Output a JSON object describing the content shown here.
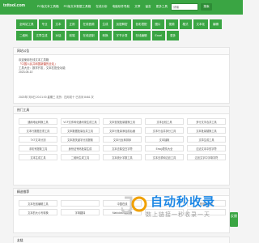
{
  "header": {
    "logo": "txttool.com",
    "nav": [
      "PC版文本工具箱",
      "PC版文本数据工具箱",
      "在线分析",
      "电脑软件导航",
      "文章",
      "留言",
      "更多工具",
      "请到"
    ],
    "search_placeholder": "请输",
    "search_button": "搜索"
  },
  "categories": [
    "全网站工具",
    "专业",
    "文本",
    "正则",
    "在线音频",
    "生成",
    "加密解密",
    "色彩搭配",
    "图片",
    "视频",
    "格式",
    "文本化",
    "编辑",
    "二维码",
    "文章生成",
    "对话",
    "前端",
    "在线进制",
    "转换",
    "字节计算",
    "在线编辑",
    "Excel",
    "更多"
  ],
  "notice": {
    "title": "网站公告",
    "lines": [
      "欢迎使用在线文本工具箱",
      "「中国人民共和国新疆的全站」",
      "工具大全：数学开发，文本匹配全功能 ",
      "2023-05-10"
    ],
    "meta": "2023年7月5日 20:21:00 星期三  农历：四月初十   已访问 8461 次"
  },
  "hot": {
    "title": "热门工具",
    "tools": [
      "通用地址转换工具",
      "VCF文件转化通讯录生成工具",
      "文本查找批量替换工具",
      "文本比较工具",
      "多行文字合并工具",
      "文本行数据去重工具",
      "文本数据批量合并工具",
      "文本行批量添加前后缀",
      "文本行合并拆分工具",
      "文本批量替换工具",
      "TXT文本分割",
      "文本按关键字分割提取",
      "文本行反转排序",
      "文本抽取",
      "文章生成工具",
      "手机号提取工具",
      "身份证号码批量生成",
      "文本去除空白字符",
      "Emoji表情大全",
      "过滤文本中的字符",
      "文本生成工具",
      "二维码生成工具",
      "文本统计字数工具",
      "文本去重和过滤工具",
      "过滤文字中字母字符"
    ]
  },
  "recommend": {
    "title": "精选推荐",
    "tools": [
      "文本在线编辑工具",
      "",
      "中国在线",
      "",
      "短网址生成",
      "文本的大小写转换",
      "字母翻译",
      "Markdown编辑器",
      "",
      ""
    ]
  },
  "bottom": {
    "title": "友链"
  },
  "side": {
    "label": "反馈"
  },
  "watermark": {
    "title": "自动秒收录",
    "subtitle": "数上链接一秒收录一天"
  }
}
